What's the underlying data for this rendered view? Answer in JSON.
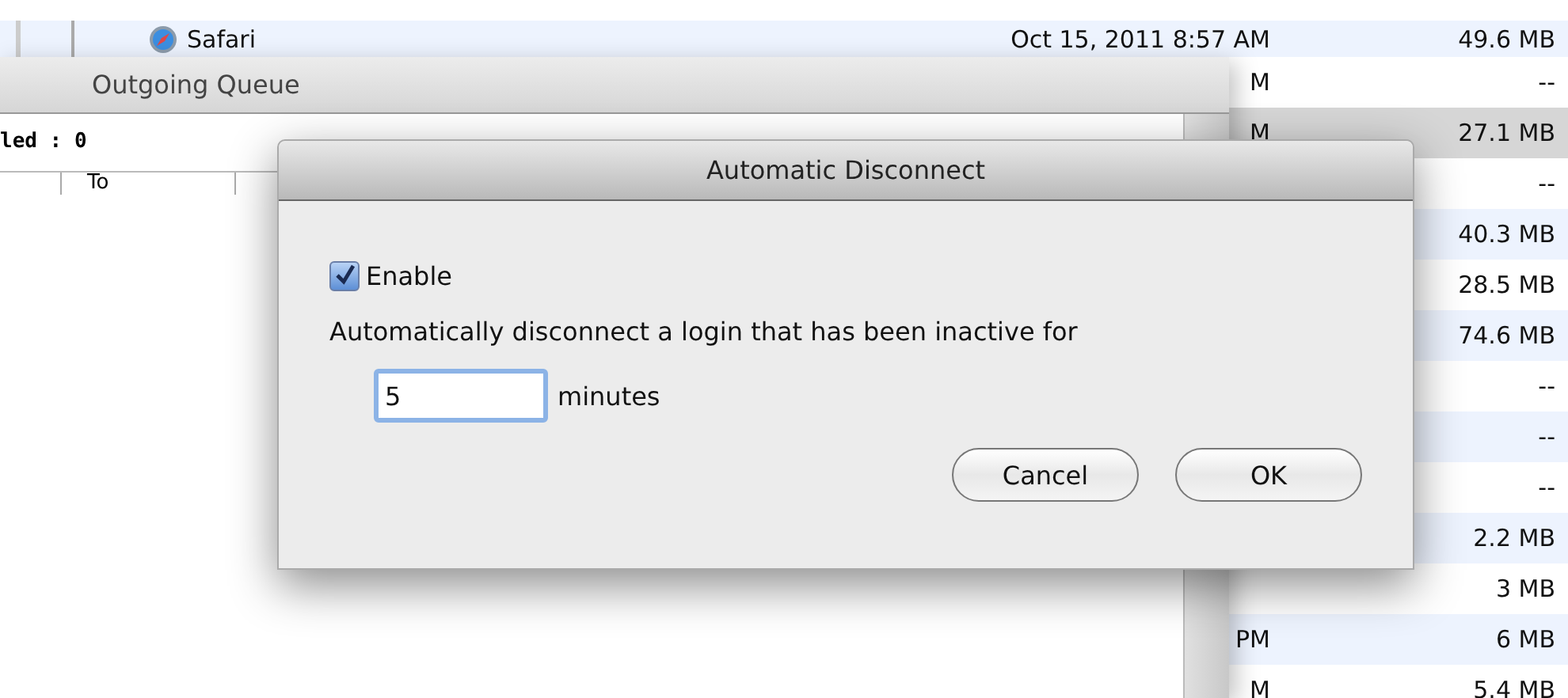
{
  "file_list": {
    "rows": [
      {
        "name": "Safari",
        "date": "Oct 15, 2011 8:57 AM",
        "size": "49.6 MB",
        "selected": false
      },
      {
        "date": "M",
        "size": "--",
        "selected": false
      },
      {
        "date": "M",
        "size": "27.1 MB",
        "selected": true
      },
      {
        "size": "--",
        "selected": false
      },
      {
        "size": "40.3 MB",
        "selected": false
      },
      {
        "size": "28.5 MB",
        "selected": false
      },
      {
        "size": "74.6 MB",
        "selected": false
      },
      {
        "size": "--",
        "selected": false
      },
      {
        "size": "--",
        "selected": false
      },
      {
        "size": "--",
        "selected": false
      },
      {
        "size": "2.2 MB",
        "selected": false
      },
      {
        "size": "3 MB",
        "selected": false
      },
      {
        "date": "PM",
        "size": "6 MB",
        "selected": false
      },
      {
        "date": "M",
        "size": "5.4 MB",
        "selected": false
      }
    ]
  },
  "queue_window": {
    "title": "Outgoing Queue",
    "status": "led : 0",
    "columns": [
      "To"
    ]
  },
  "dialog": {
    "title": "Automatic Disconnect",
    "enable": {
      "label": "Enable",
      "checked": true
    },
    "message": "Automatically disconnect a login that has been inactive for",
    "timeout": {
      "value": "5",
      "unit": "minutes"
    },
    "buttons": [
      {
        "label": "Cancel"
      },
      {
        "label": "OK"
      }
    ]
  }
}
